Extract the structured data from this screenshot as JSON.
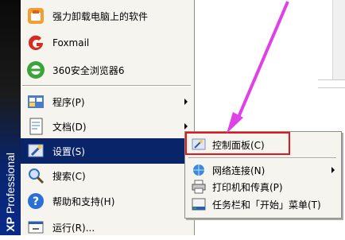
{
  "start_menu": {
    "banner_bold": "XP",
    "banner_text": "Professional",
    "recent_programs": [
      {
        "label": "强力卸载电脑上的软件",
        "icon": "uninstall-icon"
      },
      {
        "label": "Foxmail",
        "icon": "foxmail-icon"
      },
      {
        "label": "360安全浏览器6",
        "icon": "360-browser-icon"
      }
    ],
    "system_items": [
      {
        "label": "程序(P)",
        "icon": "programs-icon",
        "submenu": true
      },
      {
        "label": "文档(D)",
        "icon": "documents-icon",
        "submenu": true
      },
      {
        "label": "设置(S)",
        "icon": "settings-icon",
        "submenu": true,
        "selected": true
      },
      {
        "label": "搜索(C)",
        "icon": "search-icon",
        "submenu": true
      },
      {
        "label": "帮助和支持(H)",
        "icon": "help-icon",
        "submenu": false
      },
      {
        "label": "运行(R)...",
        "icon": "run-icon",
        "submenu": false
      }
    ]
  },
  "settings_submenu": {
    "items": [
      {
        "label": "控制面板(C)",
        "icon": "control-panel-icon",
        "submenu": false
      },
      {
        "label": "网络连接(N)",
        "icon": "network-icon",
        "submenu": true
      },
      {
        "label": "打印机和传真(P)",
        "icon": "printer-icon",
        "submenu": false
      },
      {
        "label": "任务栏和「开始」菜单(T)",
        "icon": "taskbar-icon",
        "submenu": false
      }
    ]
  },
  "colors": {
    "selection": "#0a246a",
    "highlight_box": "#e8141b",
    "pointer_arrow": "#e040e8"
  }
}
